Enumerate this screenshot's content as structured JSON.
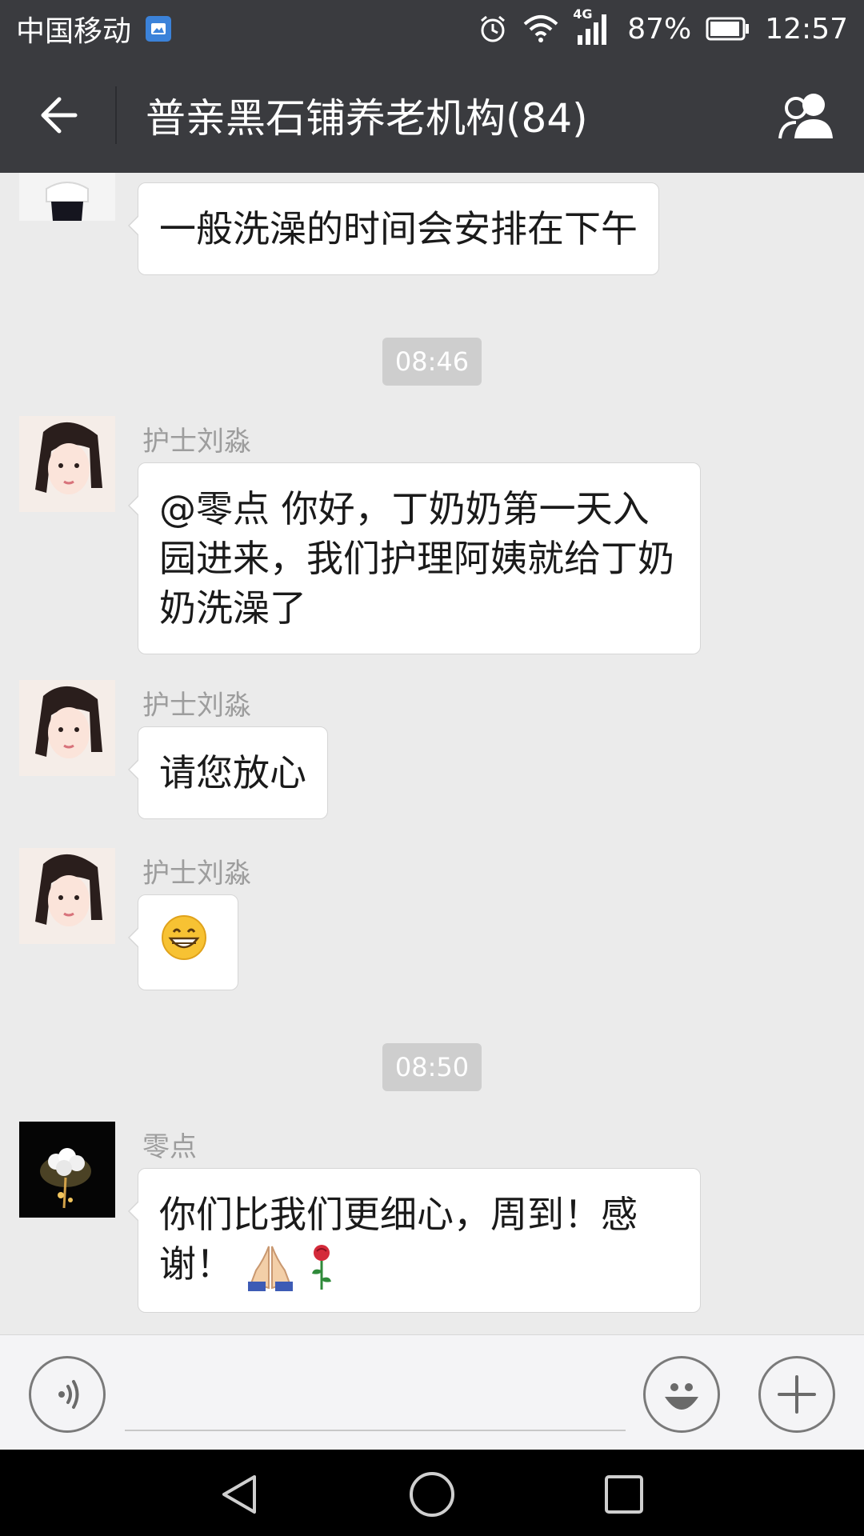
{
  "status_bar": {
    "carrier": "中国移动",
    "network": "4G",
    "battery": "87%",
    "time": "12:57"
  },
  "header": {
    "title": "普亲黑石铺养老机构(84)"
  },
  "messages": [
    {
      "sender": "",
      "text": "一般洗澡的时间会安排在下午"
    },
    {
      "time": "08:46"
    },
    {
      "sender": "护士刘淼",
      "text": "@零点 你好，丁奶奶第一天入园进来，我们护理阿姨就给丁奶奶洗澡了"
    },
    {
      "sender": "护士刘淼",
      "text": "请您放心"
    },
    {
      "sender": "护士刘淼",
      "emoji": "grinning-face"
    },
    {
      "time": "08:50"
    },
    {
      "sender": "零点",
      "text": "你们比我们更细心，周到！感谢！",
      "emojis": [
        "folded-hands",
        "rose"
      ]
    }
  ],
  "input": {
    "placeholder": ""
  },
  "colors": {
    "bar": "#3a3b3f",
    "background": "#ebebeb",
    "bubble": "#ffffff",
    "time_chip": "#cecece"
  },
  "icons": [
    "image-icon",
    "alarm-icon",
    "wifi-icon",
    "signal-icon",
    "battery-icon",
    "back-arrow-icon",
    "group-members-icon",
    "voice-icon",
    "emoji-icon",
    "plus-icon",
    "nav-back-icon",
    "nav-home-icon",
    "nav-recent-icon"
  ]
}
